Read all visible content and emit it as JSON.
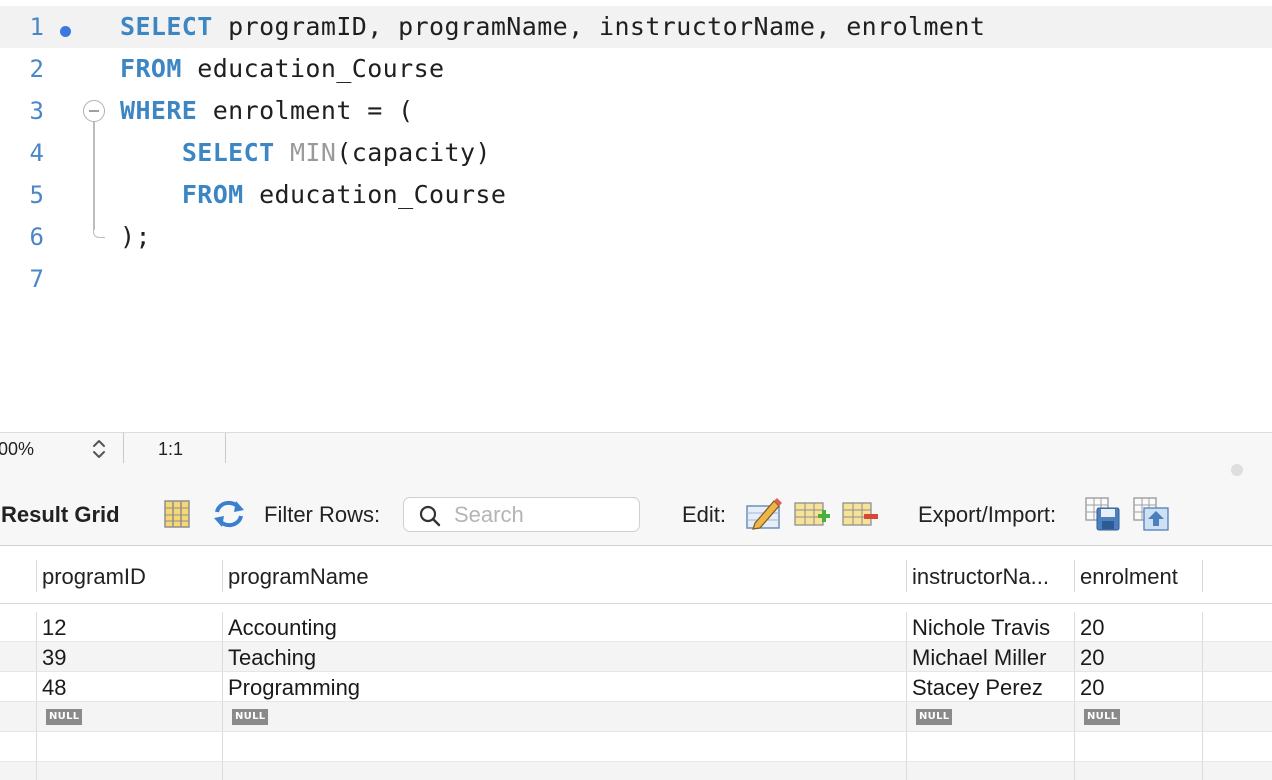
{
  "editor": {
    "lines": [
      {
        "n": "1",
        "tokens": [
          {
            "t": "SELECT",
            "c": "kw"
          },
          {
            "t": " programID, programName, instructorName, enrolment",
            "c": ""
          }
        ]
      },
      {
        "n": "2",
        "tokens": [
          {
            "t": "FROM",
            "c": "kw"
          },
          {
            "t": " education_Course",
            "c": ""
          }
        ]
      },
      {
        "n": "3",
        "tokens": [
          {
            "t": "WHERE",
            "c": "kw"
          },
          {
            "t": " enrolment = (",
            "c": ""
          }
        ]
      },
      {
        "n": "4",
        "tokens": [
          {
            "t": "    ",
            "c": ""
          },
          {
            "t": "SELECT",
            "c": "kw"
          },
          {
            "t": " ",
            "c": ""
          },
          {
            "t": "MIN",
            "c": "fn"
          },
          {
            "t": "(capacity)",
            "c": ""
          }
        ]
      },
      {
        "n": "5",
        "tokens": [
          {
            "t": "    ",
            "c": ""
          },
          {
            "t": "FROM",
            "c": "kw"
          },
          {
            "t": " education_Course",
            "c": ""
          }
        ]
      },
      {
        "n": "6",
        "tokens": [
          {
            "t": ");",
            "c": ""
          }
        ]
      },
      {
        "n": "7",
        "tokens": []
      }
    ]
  },
  "statusbar": {
    "zoom": "00%",
    "position": "1:1"
  },
  "toolbar": {
    "result_grid_label": "Result Grid",
    "filter_rows_label": "Filter Rows:",
    "search_placeholder": "Search",
    "edit_label": "Edit:",
    "export_import_label": "Export/Import:"
  },
  "grid": {
    "columns": [
      "programID",
      "programName",
      "instructorNa...",
      "enrolment"
    ],
    "rows": [
      [
        "12",
        "Accounting",
        "Nichole Travis",
        "20"
      ],
      [
        "39",
        "Teaching",
        "Michael Miller",
        "20"
      ],
      [
        "48",
        "Programming",
        "Stacey Perez",
        "20"
      ]
    ],
    "null_label": "NULL"
  },
  "colors": {
    "keyword": "#3c86c3",
    "line_number": "#4a86c8",
    "breakpoint_dot": "#3b79e0"
  }
}
